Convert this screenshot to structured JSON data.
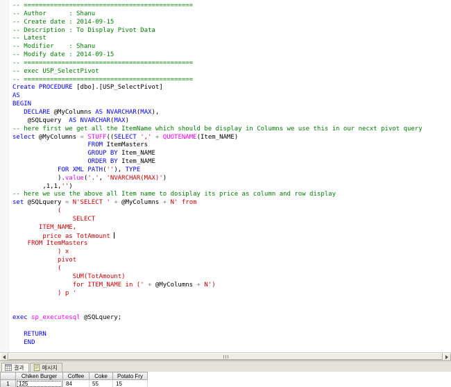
{
  "editor": {
    "colors": {
      "c": "#008000",
      "k": "#0000ff",
      "s": "#cc0000",
      "f": "#ff00ff",
      "i": "#000000",
      "o": "#808080"
    },
    "lines": [
      [
        [
          "c",
          "-- ============================================="
        ]
      ],
      [
        [
          "c",
          "-- Author      : Shanu"
        ]
      ],
      [
        [
          "c",
          "-- Create date : 2014-09-15"
        ]
      ],
      [
        [
          "c",
          "-- Description : To Display Pivot Data"
        ]
      ],
      [
        [
          "c",
          "-- Latest"
        ]
      ],
      [
        [
          "c",
          "-- Modifier    : Shanu"
        ]
      ],
      [
        [
          "c",
          "-- Modify date : 2014-09-15"
        ]
      ],
      [
        [
          "c",
          "-- ============================================="
        ]
      ],
      [
        [
          "c",
          "-- exec USP_SelectPivot"
        ]
      ],
      [
        [
          "c",
          "-- ============================================="
        ]
      ],
      [
        [
          "k",
          "Create PROCEDURE "
        ],
        [
          "i",
          "[dbo].[USP_SelectPivot]"
        ]
      ],
      [
        [
          "k",
          "AS"
        ]
      ],
      [
        [
          "k",
          "BEGIN"
        ]
      ],
      [
        [
          "i",
          "   "
        ],
        [
          "k",
          "DECLARE"
        ],
        [
          "i",
          " @MyColumns "
        ],
        [
          "k",
          "AS"
        ],
        [
          "i",
          " "
        ],
        [
          "k",
          "NVARCHAR"
        ],
        [
          "i",
          "("
        ],
        [
          "k",
          "MAX"
        ],
        [
          "i",
          "),"
        ]
      ],
      [
        [
          "i",
          "    @SQLquery  "
        ],
        [
          "k",
          "AS"
        ],
        [
          "i",
          " "
        ],
        [
          "k",
          "NVARCHAR"
        ],
        [
          "i",
          "("
        ],
        [
          "k",
          "MAX"
        ],
        [
          "i",
          ")"
        ]
      ],
      [
        [
          "c",
          "-- here first we get all the ItemName which should be display in Columns we use this in our necxt pivot query"
        ]
      ],
      [
        [
          "k",
          "select"
        ],
        [
          "i",
          " @MyColumns "
        ],
        [
          "o",
          "="
        ],
        [
          "i",
          " "
        ],
        [
          "f",
          "STUFF"
        ],
        [
          "i",
          "(("
        ],
        [
          "k",
          "SELECT"
        ],
        [
          "i",
          " "
        ],
        [
          "s",
          "','"
        ],
        [
          "i",
          " "
        ],
        [
          "o",
          "+"
        ],
        [
          "i",
          " "
        ],
        [
          "f",
          "QUOTENAME"
        ],
        [
          "i",
          "(Item_NAME)"
        ]
      ],
      [
        [
          "i",
          "                    "
        ],
        [
          "k",
          "FROM"
        ],
        [
          "i",
          " ItemMasters"
        ]
      ],
      [
        [
          "i",
          "                    "
        ],
        [
          "k",
          "GROUP BY"
        ],
        [
          "i",
          " Item_NAME"
        ]
      ],
      [
        [
          "i",
          "                    "
        ],
        [
          "k",
          "ORDER BY"
        ],
        [
          "i",
          " Item_NAME"
        ]
      ],
      [
        [
          "i",
          "            "
        ],
        [
          "k",
          "FOR XML PATH"
        ],
        [
          "i",
          "("
        ],
        [
          "s",
          "''"
        ],
        [
          "i",
          "), "
        ],
        [
          "k",
          "TYPE"
        ]
      ],
      [
        [
          "i",
          "            )."
        ],
        [
          "f",
          "value"
        ],
        [
          "i",
          "("
        ],
        [
          "s",
          "'.'"
        ],
        [
          "i",
          ", "
        ],
        [
          "s",
          "'NVARCHAR(MAX)'"
        ],
        [
          "i",
          ")"
        ]
      ],
      [
        [
          "i",
          "        ,1,1,"
        ],
        [
          "s",
          "''"
        ],
        [
          "i",
          ")"
        ]
      ],
      [
        [
          "c",
          "-- here we use the above all Item name to dosiplay its price as column and row display"
        ]
      ],
      [
        [
          "k",
          "set"
        ],
        [
          "i",
          " @SQLquery "
        ],
        [
          "o",
          "="
        ],
        [
          "i",
          " "
        ],
        [
          "s",
          "N'SELECT '"
        ],
        [
          "i",
          " "
        ],
        [
          "o",
          "+"
        ],
        [
          "i",
          " @MyColumns "
        ],
        [
          "o",
          "+"
        ],
        [
          "i",
          " "
        ],
        [
          "s",
          "N' from"
        ]
      ],
      [
        [
          "s",
          "            ("
        ]
      ],
      [
        [
          "s",
          "                SELECT"
        ]
      ],
      [
        [
          "s",
          "       ITEM_NAME,"
        ]
      ],
      [
        [
          "s",
          "        price as TotAmount "
        ],
        [
          "caret",
          ""
        ]
      ],
      [
        [
          "s",
          "    FROM ItemMasters"
        ]
      ],
      [
        [
          "s",
          "            ) x"
        ]
      ],
      [
        [
          "s",
          "            pivot"
        ]
      ],
      [
        [
          "s",
          "            ("
        ]
      ],
      [
        [
          "s",
          "                SUM(TotAmount)"
        ]
      ],
      [
        [
          "s",
          "                for ITEM_NAME in ('"
        ],
        [
          "i",
          " "
        ],
        [
          "o",
          "+"
        ],
        [
          "i",
          " @MyColumns "
        ],
        [
          "o",
          "+"
        ],
        [
          "i",
          " "
        ],
        [
          "s",
          "N')"
        ]
      ],
      [
        [
          "s",
          "            ) p '"
        ]
      ],
      [],
      [],
      [
        [
          "k",
          "exec"
        ],
        [
          "i",
          " "
        ],
        [
          "f",
          "sp_executesql"
        ],
        [
          "i",
          " @SQLquery;"
        ]
      ],
      [],
      [
        [
          "i",
          "   "
        ],
        [
          "k",
          "RETURN"
        ]
      ],
      [
        [
          "i",
          "   "
        ],
        [
          "k",
          "END"
        ]
      ]
    ]
  },
  "results_pane": {
    "tabs": [
      {
        "label": "결과",
        "icon": "results-grid-icon",
        "active": true
      },
      {
        "label": "메시지",
        "icon": "messages-icon",
        "active": false
      }
    ],
    "grid": {
      "columns": [
        "Chiken Burger",
        "Coffee",
        "Coke",
        "Potato Fry"
      ],
      "rows": [
        {
          "num": "1",
          "values": [
            "125",
            "84",
            "55",
            "15"
          ]
        }
      ],
      "selected": {
        "row": 0,
        "col": 0
      }
    }
  }
}
